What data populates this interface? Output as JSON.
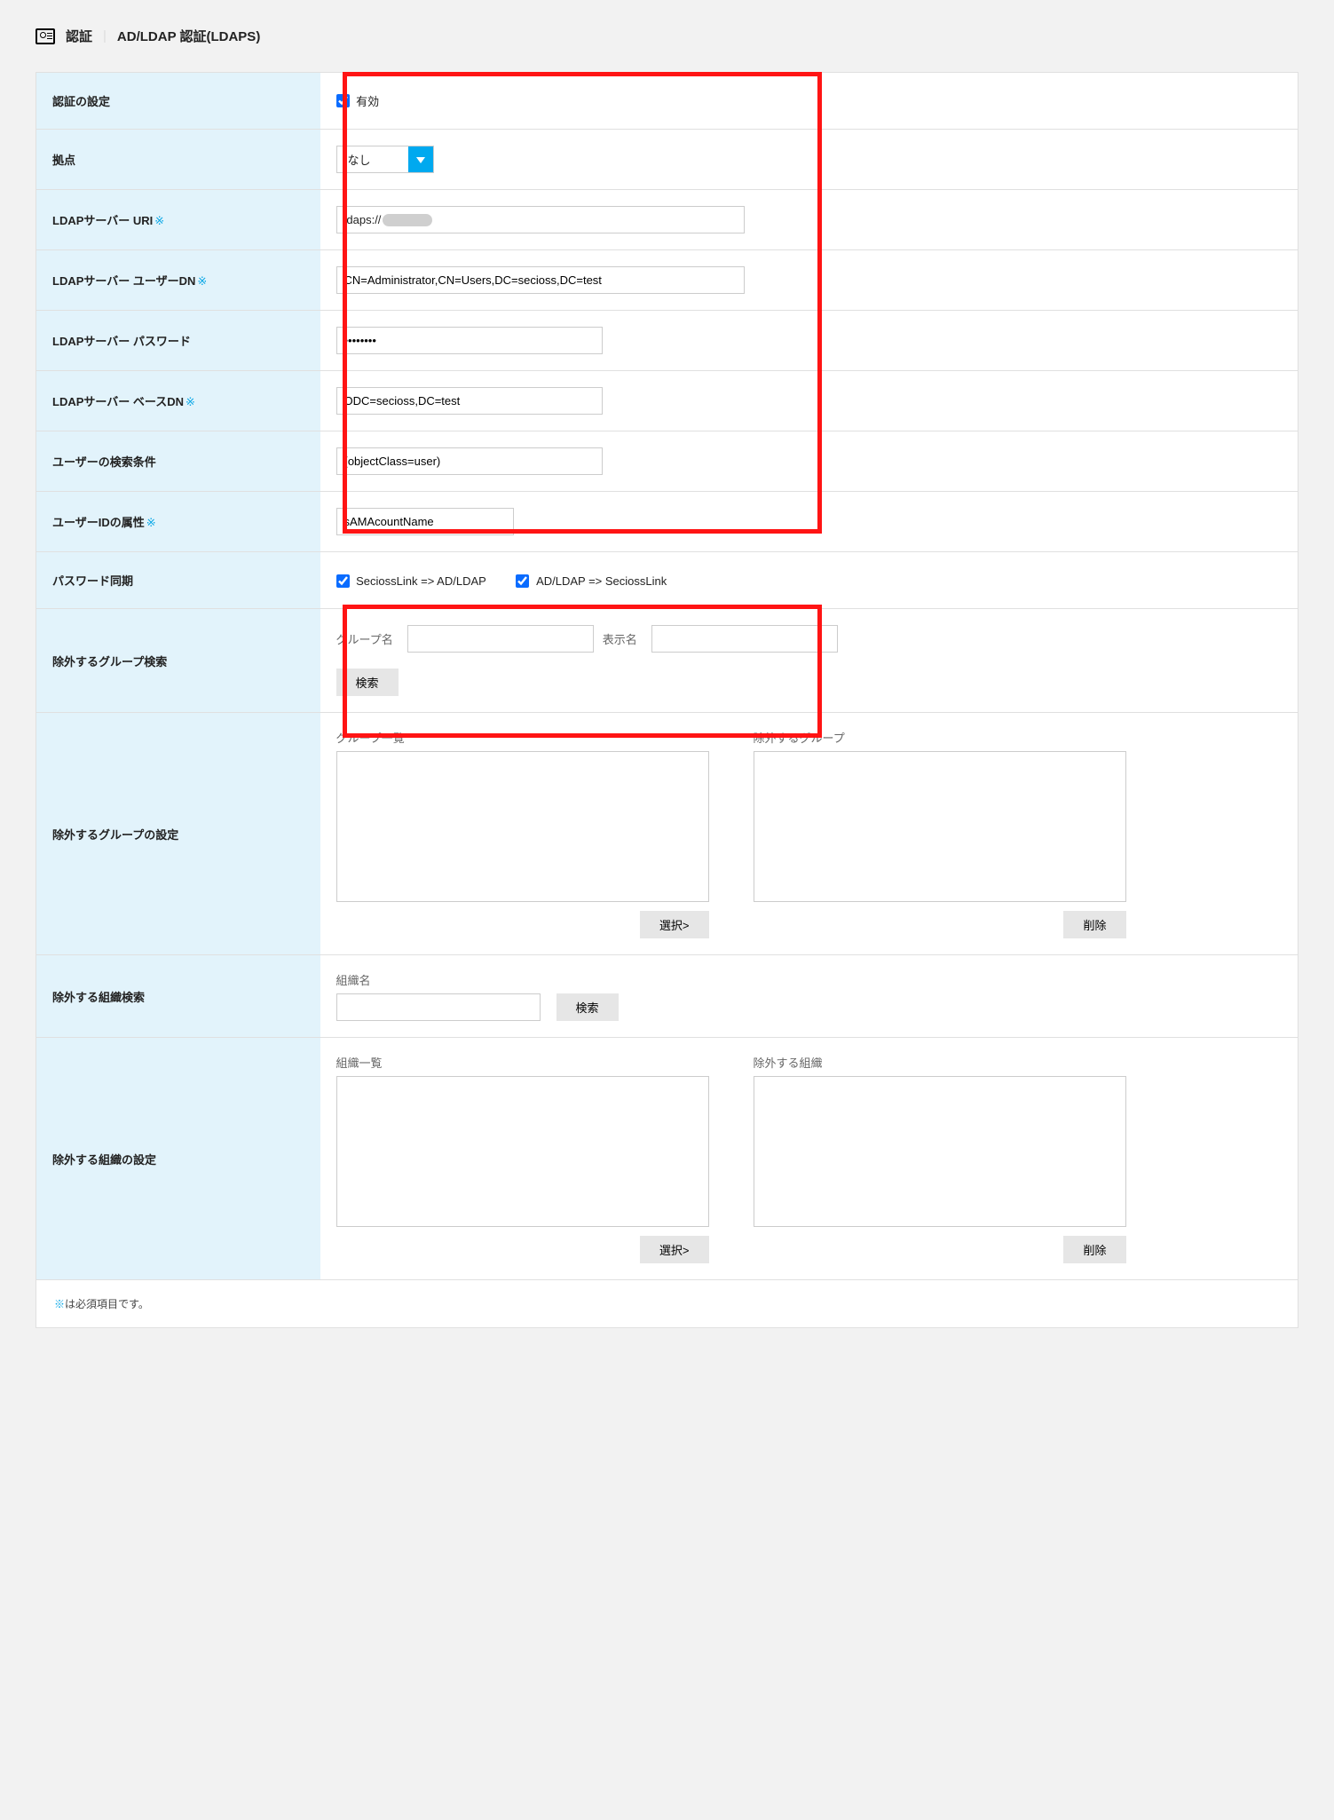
{
  "header": {
    "category": "認証",
    "page_title": "AD/LDAP 認証(LDAPS)"
  },
  "labels": {
    "auth_setting": "認証の設定",
    "site": "拠点",
    "ldap_uri": "LDAPサーバー URI",
    "ldap_user_dn": "LDAPサーバー ユーザーDN",
    "ldap_password": "LDAPサーバー パスワード",
    "ldap_base_dn": "LDAPサーバー ベースDN",
    "user_search": "ユーザーの検索条件",
    "user_id_attr": "ユーザーIDの属性",
    "password_sync": "パスワード同期",
    "exclude_group_search": "除外するグループ検索",
    "exclude_group_setting": "除外するグループの設定",
    "exclude_org_search": "除外する組織検索",
    "exclude_org_setting": "除外する組織の設定",
    "required_mark": "※"
  },
  "values": {
    "enabled_label": "有効",
    "enabled_checked": true,
    "site_selected": "なし",
    "ldap_uri_prefix": "ldaps://",
    "ldap_user_dn": "CN=Administrator,CN=Users,DC=secioss,DC=test",
    "ldap_password": "••••••••",
    "ldap_base_dn": "ODC=secioss,DC=test",
    "user_search": "(objectClass=user)",
    "user_id_attr": "sAMAcountName",
    "sync1_label": "SeciossLink => AD/LDAP",
    "sync1_checked": true,
    "sync2_label": "AD/LDAP => SeciossLink",
    "sync2_checked": true
  },
  "sublabels": {
    "group_name": "グループ名",
    "display_name": "表示名",
    "search_btn": "検索",
    "group_list": "グループ一覧",
    "exclude_group": "除外するグループ",
    "select_btn": "選択>",
    "delete_btn": "削除",
    "org_name": "組織名",
    "org_list": "組織一覧",
    "exclude_org": "除外する組織"
  },
  "footer": {
    "note_prefix": "※",
    "note_text": "は必須項目です。"
  }
}
